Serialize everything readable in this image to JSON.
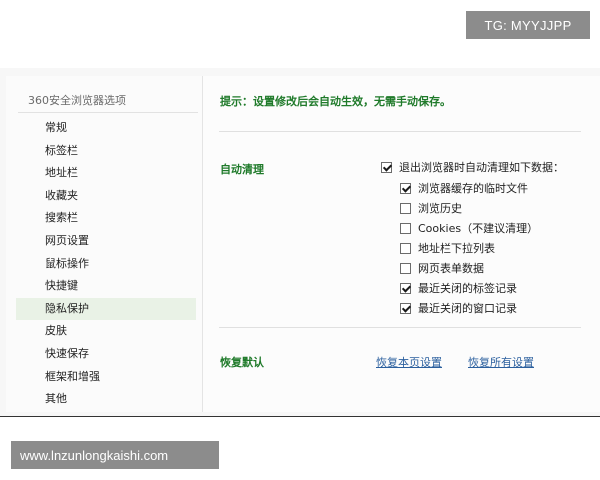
{
  "watermark_top": "TG: MYYJJPP",
  "watermark_bottom": "www.lnzunlongkaishi.com",
  "sidebar": {
    "title": "360安全浏览器选项",
    "items": [
      {
        "label": "常规"
      },
      {
        "label": "标签栏"
      },
      {
        "label": "地址栏"
      },
      {
        "label": "收藏夹"
      },
      {
        "label": "搜索栏"
      },
      {
        "label": "网页设置"
      },
      {
        "label": "鼠标操作"
      },
      {
        "label": "快捷键"
      },
      {
        "label": "隐私保护",
        "active": true
      },
      {
        "label": "皮肤"
      },
      {
        "label": "快速保存"
      },
      {
        "label": "框架和增强"
      },
      {
        "label": "其他"
      }
    ]
  },
  "main": {
    "tip": "提示：设置修改后会自动生效，无需手动保存。",
    "auto_clean": {
      "label": "自动清理",
      "master": {
        "label": "退出浏览器时自动清理如下数据：",
        "checked": true
      },
      "options": [
        {
          "label": "浏览器缓存的临时文件",
          "checked": true
        },
        {
          "label": "浏览历史",
          "checked": false
        },
        {
          "label": "Cookies（不建议清理）",
          "checked": false
        },
        {
          "label": "地址栏下拉列表",
          "checked": false
        },
        {
          "label": "网页表单数据",
          "checked": false
        },
        {
          "label": "最近关闭的标签记录",
          "checked": true
        },
        {
          "label": "最近关闭的窗口记录",
          "checked": true
        }
      ]
    },
    "restore": {
      "label": "恢复默认",
      "restore_page": "恢复本页设置",
      "restore_all": "恢复所有设置"
    }
  }
}
